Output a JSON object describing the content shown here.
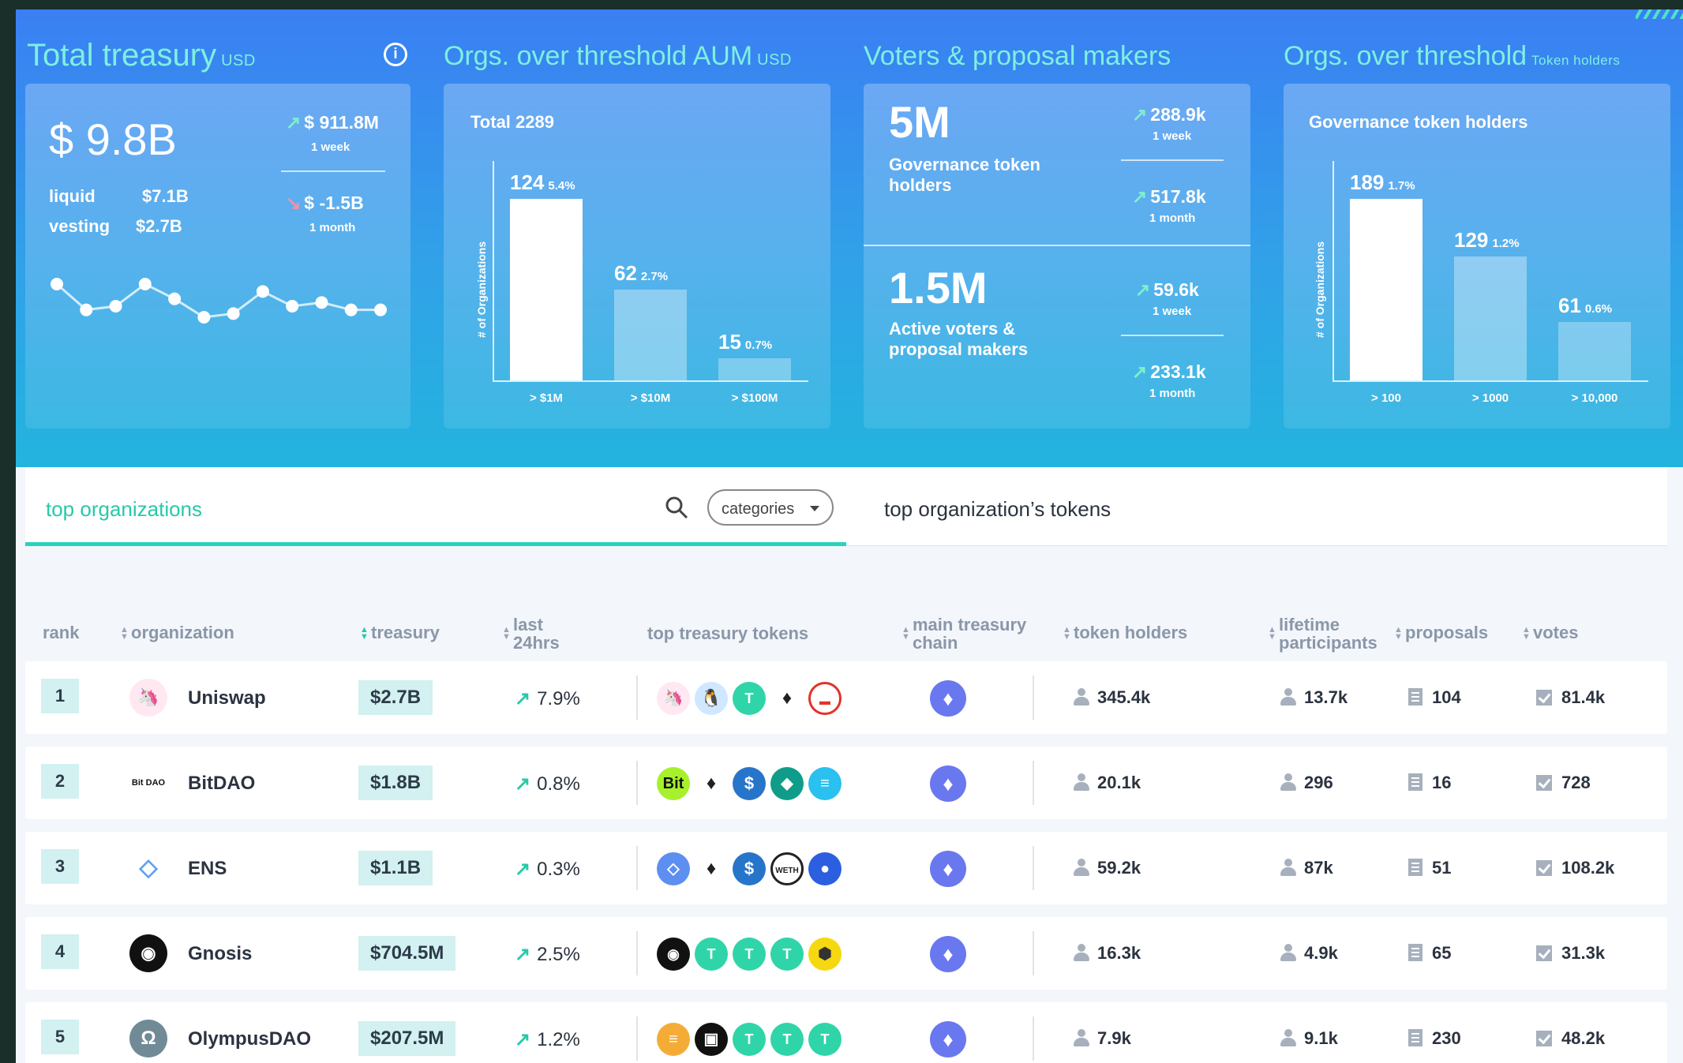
{
  "total_treasury": {
    "title": "Total treasury",
    "unit": "USD",
    "value": "$ 9.8B",
    "liquid_label": "liquid",
    "liquid_value": "$7.1B",
    "vesting_label": "vesting",
    "vesting_value": "$2.7B",
    "week_delta": "$ 911.8M",
    "week_label": "1 week",
    "month_delta": "$ -1.5B",
    "month_label": "1 month",
    "trend": [
      4.6,
      3.9,
      4.0,
      4.6,
      4.2,
      3.7,
      3.8,
      4.4,
      4.0,
      4.1,
      3.9,
      3.9
    ]
  },
  "aum": {
    "title": "Orgs. over threshold AUM",
    "unit": "USD",
    "chart_data": {
      "type": "bar",
      "title": "Total 2289",
      "ylabel": "# of Organizations",
      "categories": [
        "> $1M",
        "> $10M",
        "> $100M"
      ],
      "values": [
        124,
        62,
        15
      ],
      "percents": [
        "5.4%",
        "2.7%",
        "0.7%"
      ]
    }
  },
  "voters": {
    "title": "Voters & proposal makers",
    "holders_value": "5M",
    "holders_label": "Governance token holders",
    "holders_week": "288.9k",
    "holders_month": "517.8k",
    "active_value": "1.5M",
    "active_label": "Active voters & proposal makers",
    "active_week": "59.6k",
    "active_month": "233.1k",
    "week_label": "1 week",
    "month_label": "1 month"
  },
  "holders": {
    "title": "Orgs. over threshold",
    "unit": "Token holders",
    "chart_data": {
      "type": "bar",
      "title": "Governance token holders",
      "ylabel": "# of Organizations",
      "categories": [
        "> 100",
        "> 1000",
        "> 10,000"
      ],
      "values": [
        189,
        129,
        61
      ],
      "percents": [
        "1.7%",
        "1.2%",
        "0.6%"
      ]
    }
  },
  "tabs": {
    "left": "top organizations",
    "right": "top organization’s tokens",
    "categories_button": "categories"
  },
  "columns": {
    "rank": "rank",
    "organization": "organization",
    "treasury": "treasury",
    "last24_1": "last",
    "last24_2": "24hrs",
    "top_tokens": "top treasury tokens",
    "chain_1": "main treasury",
    "chain_2": "chain",
    "token_holders": "token holders",
    "lifetime_1": "lifetime",
    "lifetime_2": "participants",
    "proposals": "proposals",
    "votes": "votes"
  },
  "rows": [
    {
      "rank": "1",
      "name": "Uniswap",
      "treasury": "$2.7B",
      "change": "7.9%",
      "holders": "345.4k",
      "participants": "13.7k",
      "proposals": "104",
      "votes": "81.4k"
    },
    {
      "rank": "2",
      "name": "BitDAO",
      "treasury": "$1.8B",
      "change": "0.8%",
      "holders": "20.1k",
      "participants": "296",
      "proposals": "16",
      "votes": "728"
    },
    {
      "rank": "3",
      "name": "ENS",
      "treasury": "$1.1B",
      "change": "0.3%",
      "holders": "59.2k",
      "participants": "87k",
      "proposals": "51",
      "votes": "108.2k"
    },
    {
      "rank": "4",
      "name": "Gnosis",
      "treasury": "$704.5M",
      "change": "2.5%",
      "holders": "16.3k",
      "participants": "4.9k",
      "proposals": "65",
      "votes": "31.3k"
    },
    {
      "rank": "5",
      "name": "OlympusDAO",
      "treasury": "$207.5M",
      "change": "1.2%",
      "holders": "7.9k",
      "participants": "9.1k",
      "proposals": "230",
      "votes": "48.2k"
    }
  ],
  "logo_text": {
    "bitdao": "Bit DAO",
    "bit_token": "Bit",
    "weth_token": "WETH"
  },
  "colors": {
    "accent": "#27d3b9",
    "hero_top": "#3a7ff3",
    "hero_bottom": "#23b4de",
    "eth": "#6a78ef"
  }
}
